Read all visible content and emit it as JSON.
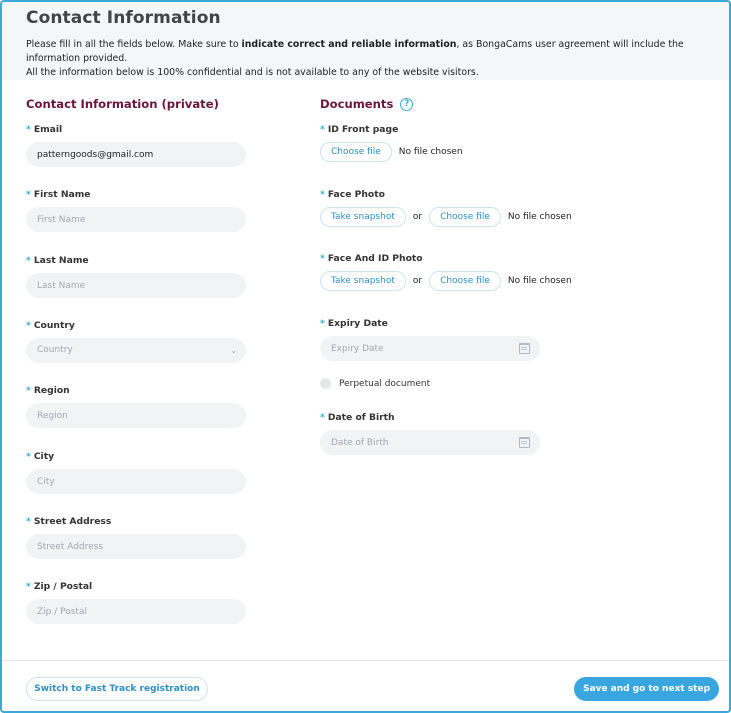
{
  "header": {
    "title": "Contact Information",
    "intro_pre": "Please fill in all the fields below. Make sure to ",
    "intro_bold": "indicate correct and reliable information",
    "intro_post": ", as BongaCams user agreement will include the information provided.",
    "intro_line2": "All the information below is 100% confidential and is not available to any of the website visitors."
  },
  "required_mark": "*",
  "contact": {
    "section_title": "Contact Information (private)",
    "email": {
      "label": "Email",
      "value": "patterngoods@gmail.com"
    },
    "first_name": {
      "label": "First Name",
      "placeholder": "First Name"
    },
    "last_name": {
      "label": "Last Name",
      "placeholder": "Last Name"
    },
    "country": {
      "label": "Country",
      "placeholder": "Country"
    },
    "region": {
      "label": "Region",
      "placeholder": "Region"
    },
    "city": {
      "label": "City",
      "placeholder": "City"
    },
    "street": {
      "label": "Street Address",
      "placeholder": "Street Address"
    },
    "zip": {
      "label": "Zip / Postal",
      "placeholder": "Zip / Postal"
    }
  },
  "documents": {
    "section_title": "Documents",
    "help_icon": "?",
    "id_front": {
      "label": "ID Front page",
      "choose": "Choose file",
      "status": "No file chosen"
    },
    "face_photo": {
      "label": "Face Photo",
      "snapshot": "Take snapshot",
      "or": "or",
      "choose": "Choose file",
      "status": "No file chosen"
    },
    "face_id_photo": {
      "label": "Face And ID Photo",
      "snapshot": "Take snapshot",
      "or": "or",
      "choose": "Choose file",
      "status": "No file chosen"
    },
    "expiry": {
      "label": "Expiry Date",
      "placeholder": "Expiry Date"
    },
    "perpetual": {
      "label": "Perpetual document"
    },
    "dob": {
      "label": "Date of Birth",
      "placeholder": "Date of Birth"
    }
  },
  "footer": {
    "fast_track": "Switch to Fast Track registration",
    "next": "Save and go to next step"
  },
  "colors": {
    "accent": "#39a9dc",
    "section_title": "#6b1539",
    "primary_button": "#3aa6df"
  }
}
